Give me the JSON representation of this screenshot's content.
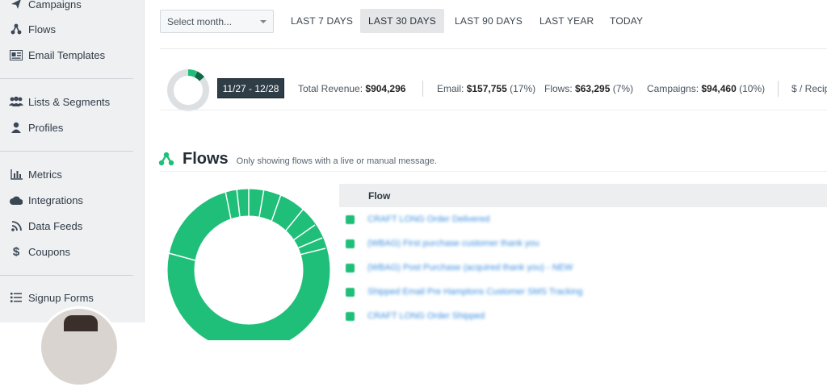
{
  "sidebar": {
    "items": [
      {
        "label": "Campaigns",
        "icon": "paper-plane-icon"
      },
      {
        "label": "Flows",
        "icon": "flows-icon"
      },
      {
        "label": "Email Templates",
        "icon": "template-icon"
      },
      {
        "label": "Lists & Segments",
        "icon": "users-icon"
      },
      {
        "label": "Profiles",
        "icon": "user-icon"
      },
      {
        "label": "Metrics",
        "icon": "bar-chart-icon"
      },
      {
        "label": "Integrations",
        "icon": "cloud-icon"
      },
      {
        "label": "Data Feeds",
        "icon": "rss-icon"
      },
      {
        "label": "Coupons",
        "icon": "dollar-icon"
      },
      {
        "label": "Signup Forms",
        "icon": "list-icon"
      }
    ]
  },
  "toolbar": {
    "month_select": "Select month...",
    "ranges": [
      "LAST 7 DAYS",
      "LAST 30 DAYS",
      "LAST 90 DAYS",
      "LAST YEAR",
      "TODAY"
    ],
    "active_range": "LAST 30 DAYS"
  },
  "summary": {
    "date_range": "11/27 - 12/28",
    "total_revenue_label": "Total Revenue:",
    "total_revenue_value": "$904,296",
    "email_label": "Email:",
    "email_value": "$157,755",
    "email_pct": "(17%)",
    "flows_label": "Flows:",
    "flows_value": "$63,295",
    "flows_pct": "(7%)",
    "campaigns_label": "Campaigns:",
    "campaigns_value": "$94,460",
    "campaigns_pct": "(10%)",
    "per_recipient_label": "$ / Recip"
  },
  "flows_section": {
    "title": "Flows",
    "note": "Only showing flows with a live or manual message.",
    "table_header": "Flow",
    "rows": [
      "CRAFT LONG Order Delivered",
      "(WBAG) First purchase customer thank you",
      "(WBAG) Post Purchase (acquired thank you) - NEW",
      "Shipped Email Pre Hamptons Customer SMS Tracking",
      "CRAFT LONG Order Shipped"
    ]
  },
  "colors": {
    "accent_green": "#1fbf79",
    "dark_green": "#0f6b45",
    "donut_track": "#dde0e3",
    "link_blue": "#3b8fe0"
  }
}
